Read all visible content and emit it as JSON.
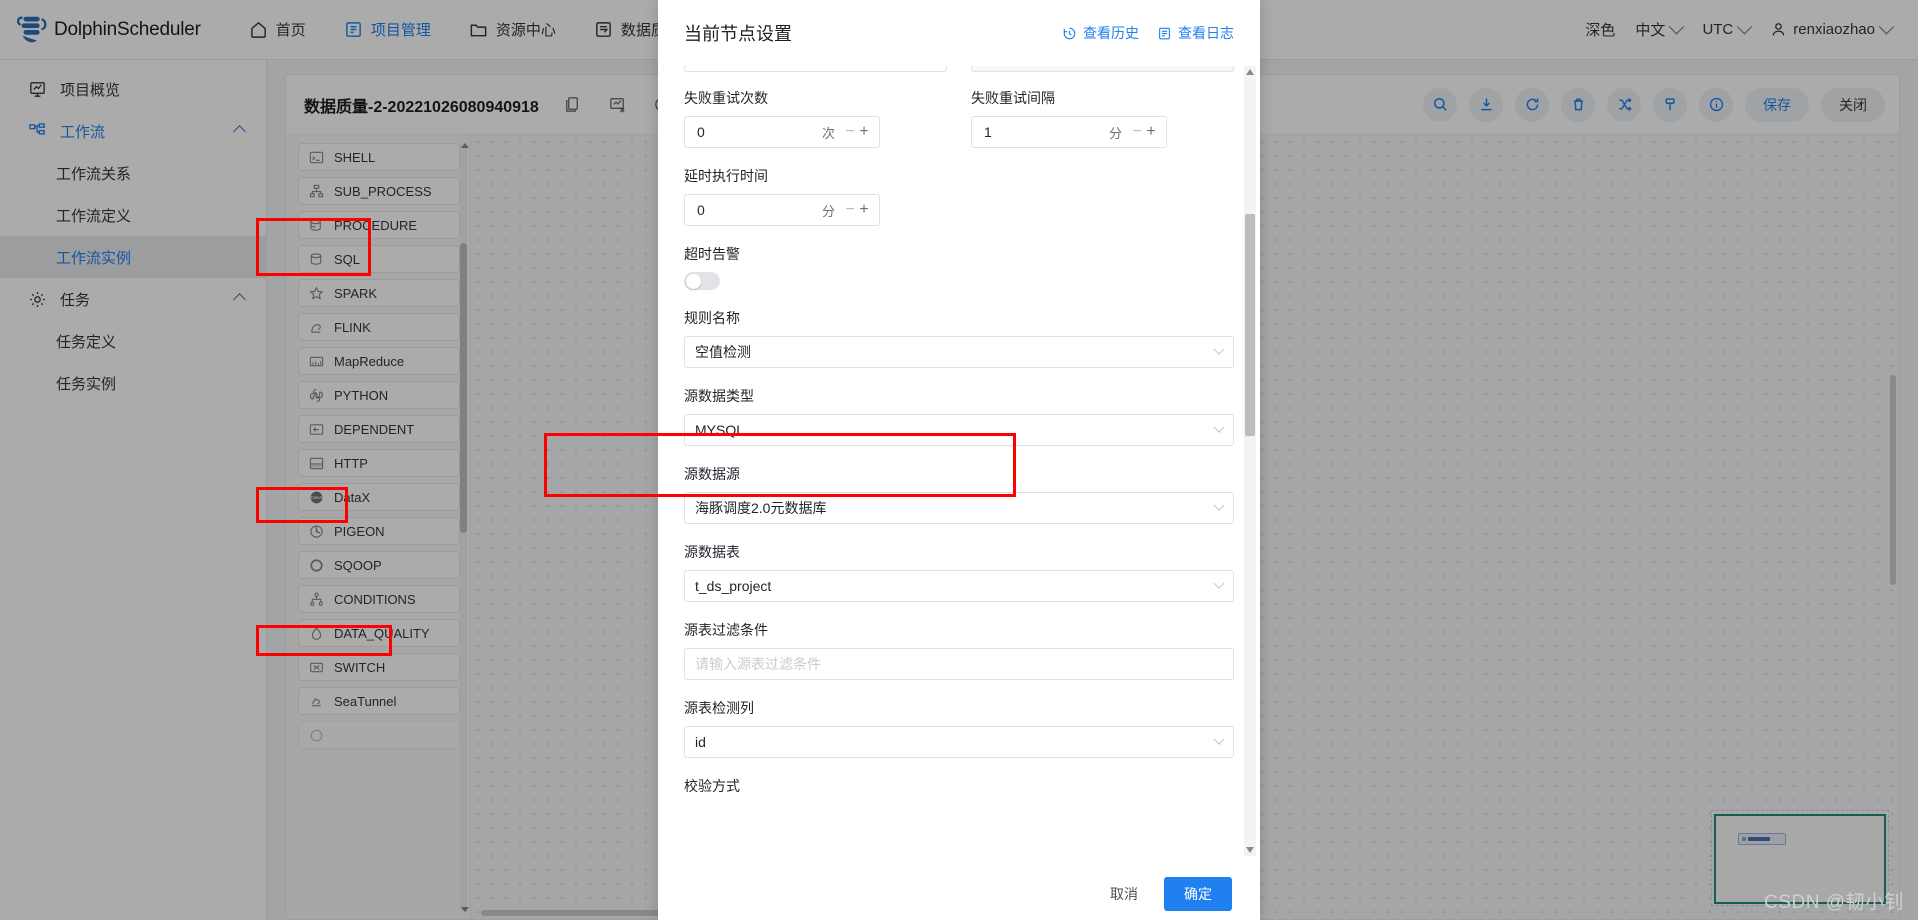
{
  "header": {
    "brand": "DolphinScheduler",
    "nav": [
      {
        "label": "首页",
        "icon": "home-icon",
        "active": false
      },
      {
        "label": "项目管理",
        "icon": "project-icon",
        "active": true
      },
      {
        "label": "资源中心",
        "icon": "folder-icon",
        "active": false
      },
      {
        "label": "数据质量",
        "icon": "data-quality-icon",
        "active": false
      }
    ],
    "theme_label": "深色",
    "language_label": "中文",
    "timezone_label": "UTC",
    "user_label": "renxiaozhao"
  },
  "sidebar": {
    "items": [
      {
        "label": "项目概览",
        "icon": "overview-icon",
        "type": "row"
      },
      {
        "label": "工作流",
        "icon": "workflow-icon",
        "type": "group",
        "expanded": true
      },
      {
        "label": "工作流关系",
        "type": "child"
      },
      {
        "label": "工作流定义",
        "type": "child"
      },
      {
        "label": "工作流实例",
        "type": "child",
        "selected": true
      },
      {
        "label": "任务",
        "icon": "gear-icon",
        "type": "group",
        "expanded": true
      },
      {
        "label": "任务定义",
        "type": "child"
      },
      {
        "label": "任务实例",
        "type": "child"
      }
    ]
  },
  "toolbar": {
    "workflow_name": "数据质量-2-20221026080940918",
    "left_icons": [
      "copy-icon",
      "edit-chart-icon",
      "clock-icon"
    ],
    "right_icons": [
      "search-icon",
      "download-icon",
      "refresh-icon",
      "delete-icon",
      "shuffle-icon",
      "format-icon",
      "info-icon"
    ],
    "save_label": "保存",
    "close_label": "关闭"
  },
  "task_panel": {
    "items": [
      {
        "label": "SHELL",
        "icon": "shell-icon",
        "highlighted": false
      },
      {
        "label": "SUB_PROCESS",
        "icon": "subprocess-icon",
        "highlighted": false
      },
      {
        "label": "PROCEDURE",
        "icon": "procedure-icon",
        "highlighted": true
      },
      {
        "label": "SQL",
        "icon": "sql-icon",
        "highlighted": true
      },
      {
        "label": "SPARK",
        "icon": "spark-icon",
        "highlighted": false
      },
      {
        "label": "FLINK",
        "icon": "flink-icon",
        "highlighted": false
      },
      {
        "label": "MapReduce",
        "icon": "mapreduce-icon",
        "highlighted": false
      },
      {
        "label": "PYTHON",
        "icon": "python-icon",
        "highlighted": false
      },
      {
        "label": "DEPENDENT",
        "icon": "dependent-icon",
        "highlighted": false
      },
      {
        "label": "HTTP",
        "icon": "http-icon",
        "highlighted": false
      },
      {
        "label": "DataX",
        "icon": "datax-icon",
        "highlighted": true
      },
      {
        "label": "PIGEON",
        "icon": "pigeon-icon",
        "highlighted": false
      },
      {
        "label": "SQOOP",
        "icon": "sqoop-icon",
        "highlighted": false
      },
      {
        "label": "CONDITIONS",
        "icon": "conditions-icon",
        "highlighted": false
      },
      {
        "label": "DATA_QUALITY",
        "icon": "data-quality-drop-icon",
        "highlighted": true
      },
      {
        "label": "SWITCH",
        "icon": "switch-icon",
        "highlighted": false
      },
      {
        "label": "SeaTunnel",
        "icon": "seatunnel-icon",
        "highlighted": false
      }
    ]
  },
  "modal": {
    "title": "当前节点设置",
    "view_history_label": "查看历史",
    "view_log_label": "查看日志",
    "fields": {
      "retry_times": {
        "label": "失败重试次数",
        "value": "0",
        "unit": "次"
      },
      "retry_interval": {
        "label": "失败重试间隔",
        "value": "1",
        "unit": "分"
      },
      "delay_exec": {
        "label": "延时执行时间",
        "value": "0",
        "unit": "分"
      },
      "timeout_alarm": {
        "label": "超时告警",
        "value": "off"
      },
      "rule_name": {
        "label": "规则名称",
        "value": "空值检测"
      },
      "src_datasource_type": {
        "label": "源数据类型",
        "value": "MYSQL"
      },
      "src_datasource": {
        "label": "源数据源",
        "value": "海豚调度2.0元数据库"
      },
      "src_table": {
        "label": "源数据表",
        "value": "t_ds_project"
      },
      "src_filter": {
        "label": "源表过滤条件",
        "value": "",
        "placeholder": "请输入源表过滤条件"
      },
      "src_check_column": {
        "label": "源表检测列",
        "value": "id"
      },
      "check_method": {
        "label": "校验方式"
      }
    },
    "cancel_label": "取消",
    "confirm_label": "确定"
  },
  "watermark": "CSDN @韧小钊",
  "colors": {
    "accent": "#2080f0",
    "annotation": "#ff0000",
    "minimap_border": "#18907f"
  }
}
